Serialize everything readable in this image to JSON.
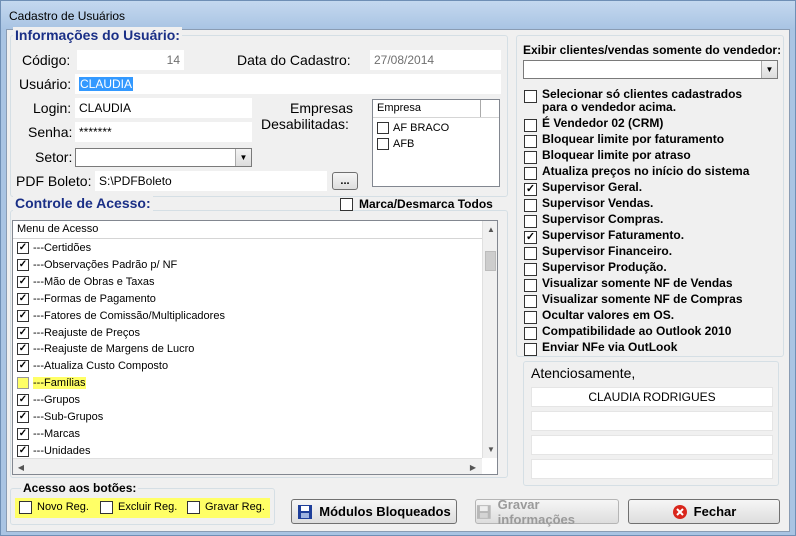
{
  "window": {
    "title": "Cadastro de Usuários"
  },
  "info": {
    "title": "Informações do Usuário:",
    "codigo_label": "Código:",
    "codigo_value": "14",
    "data_label": "Data do Cadastro:",
    "data_value": "27/08/2014",
    "usuario_label": "Usuário:",
    "usuario_value": "CLAUDIA",
    "login_label": "Login:",
    "login_value": "CLAUDIA",
    "senha_label": "Senha:",
    "senha_value": "*******",
    "setor_label": "Setor:",
    "setor_value": "",
    "pdf_label": "PDF Boleto:",
    "pdf_value": "S:\\PDFBoleto",
    "pdf_browse": "...",
    "empresas_label_1": "Empresas",
    "empresas_label_2": "Desabilitadas:",
    "empresas_header": "Empresa",
    "empresas": [
      {
        "name": "AF BRACO",
        "checked": false
      },
      {
        "name": "AFB",
        "checked": false
      }
    ]
  },
  "controle": {
    "title": "Controle de Acesso:",
    "toggle_all_label": "Marca/Desmarca Todos",
    "header": "Menu de Acesso",
    "items": [
      {
        "label": "---Certidões",
        "checked": true
      },
      {
        "label": "---Observações Padrão p/ NF",
        "checked": true
      },
      {
        "label": "---Mão de Obras e Taxas",
        "checked": true
      },
      {
        "label": "---Formas de Pagamento",
        "checked": true
      },
      {
        "label": "---Fatores de Comissão/Multiplicadores",
        "checked": true
      },
      {
        "label": "---Reajuste de Preços",
        "checked": true
      },
      {
        "label": "---Reajuste de Margens de Lucro",
        "checked": true
      },
      {
        "label": "---Atualiza Custo Composto",
        "checked": true
      },
      {
        "label": "---Famílias",
        "checked": false,
        "highlight": true
      },
      {
        "label": "---Grupos",
        "checked": true
      },
      {
        "label": "---Sub-Grupos",
        "checked": true
      },
      {
        "label": "---Marcas",
        "checked": true
      },
      {
        "label": "---Unidades",
        "checked": true
      }
    ]
  },
  "botoes": {
    "title": "Acesso aos botões:",
    "novo": "Novo Reg.",
    "excluir": "Excluir Reg.",
    "gravar": "Gravar Reg."
  },
  "buttons": {
    "modulos": "Módulos Bloqueados",
    "gravar": "Gravar informações",
    "fechar": "Fechar"
  },
  "right": {
    "vendedor_label": "Exibir clientes/vendas somente do vendedor:",
    "vendedor_value": "",
    "options": [
      {
        "label": "Selecionar só clientes cadastrados",
        "label2": "para o vendedor acima.",
        "checked": false
      },
      {
        "label": "É Vendedor 02 (CRM)",
        "checked": false
      },
      {
        "label": "Bloquear limite por faturamento",
        "checked": false
      },
      {
        "label": "Bloquear limite por atraso",
        "checked": false
      },
      {
        "label": "Atualiza preços no início do sistema",
        "checked": false
      },
      {
        "label": "Supervisor Geral.",
        "checked": true
      },
      {
        "label": "Supervisor Vendas.",
        "checked": false
      },
      {
        "label": "Supervisor Compras.",
        "checked": false
      },
      {
        "label": "Supervisor Faturamento.",
        "checked": true
      },
      {
        "label": "Supervisor Financeiro.",
        "checked": false
      },
      {
        "label": "Supervisor Produção.",
        "checked": false
      },
      {
        "label": "Visualizar somente NF de Vendas",
        "checked": false
      },
      {
        "label": "Visualizar somente NF de Compras",
        "checked": false
      },
      {
        "label": "Ocultar valores em OS.",
        "checked": false
      },
      {
        "label": "Compatibilidade ao Outlook 2010",
        "checked": false
      },
      {
        "label": "Enviar NFe via OutLook",
        "checked": false
      }
    ],
    "signature_title": "Atenciosamente,",
    "signature_lines": [
      "CLAUDIA RODRIGUES",
      "",
      "",
      ""
    ]
  },
  "icons": {
    "disk": "floppy-disk-icon",
    "close": "close-circle-icon"
  },
  "colors": {
    "group_title": "#1a2f86",
    "highlight": "#ffff66",
    "selection": "#3399ff",
    "close_red": "#d9261c"
  }
}
